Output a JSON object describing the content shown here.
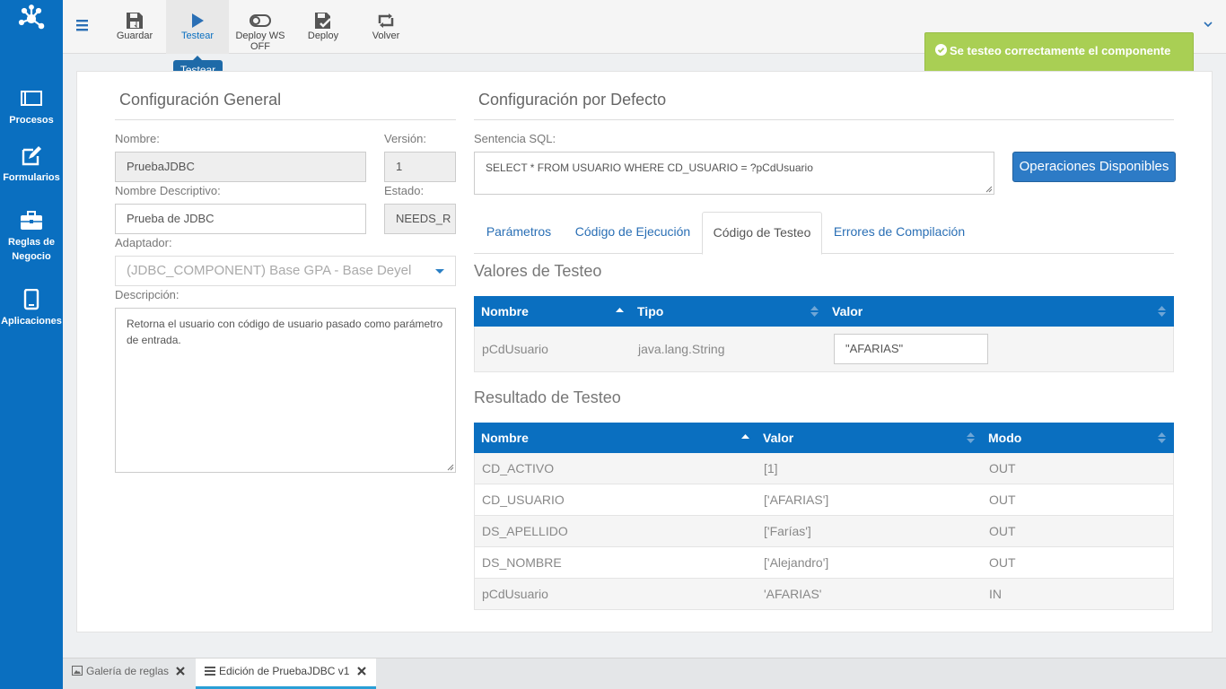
{
  "sidebar": {
    "items": [
      {
        "label": "Procesos",
        "icon": "window-icon"
      },
      {
        "label": "Formularios",
        "icon": "edit-form-icon"
      },
      {
        "label": "Reglas de Negocio",
        "icon": "briefcase-icon"
      },
      {
        "label": "Aplicaciones",
        "icon": "tablet-icon"
      }
    ]
  },
  "toolbar": {
    "items": [
      {
        "label": "Guardar",
        "icon": "save-icon"
      },
      {
        "label": "Testear",
        "icon": "play-icon"
      },
      {
        "label": "Deploy WS OFF",
        "icon": "toggle-off-icon"
      },
      {
        "label": "Deploy",
        "icon": "deploy-icon"
      },
      {
        "label": "Volver",
        "icon": "retweet-icon"
      }
    ],
    "tooltip": "Testear"
  },
  "toast": {
    "message": "Se testeo correctamente el componente",
    "color": "#a9cf54"
  },
  "general": {
    "title": "Configuración General",
    "nombre_label": "Nombre:",
    "nombre_value": "PruebaJDBC",
    "version_label": "Versión:",
    "version_value": "1",
    "descriptivo_label": "Nombre Descriptivo:",
    "descriptivo_value": "Prueba de JDBC",
    "estado_label": "Estado:",
    "estado_value": "NEEDS_R",
    "adaptador_label": "Adaptador:",
    "adaptador_value": "(JDBC_COMPONENT) Base GPA - Base Deyel",
    "descripcion_label": "Descripción:",
    "descripcion_value": "Retorna el usuario con código de usuario pasado como parámetro de entrada."
  },
  "defecto": {
    "title": "Configuración por Defecto",
    "sql_label": "Sentencia SQL:",
    "sql_value": "SELECT * FROM USUARIO WHERE CD_USUARIO = ?pCdUsuario",
    "operaciones_button": "Operaciones Disponibles"
  },
  "tabs": [
    {
      "label": "Parámetros"
    },
    {
      "label": "Código de Ejecución"
    },
    {
      "label": "Código de Testeo"
    },
    {
      "label": "Errores de Compilación"
    }
  ],
  "valores": {
    "title": "Valores de Testeo",
    "headers": [
      "Nombre",
      "Tipo",
      "Valor"
    ],
    "row": {
      "nombre": "pCdUsuario",
      "tipo": "java.lang.String",
      "valor": "\"AFARIAS\""
    }
  },
  "resultado": {
    "title": "Resultado de Testeo",
    "headers": [
      "Nombre",
      "Valor",
      "Modo"
    ],
    "rows": [
      {
        "nombre": "CD_ACTIVO",
        "valor": "[1]",
        "modo": "OUT"
      },
      {
        "nombre": "CD_USUARIO",
        "valor": "['AFARIAS']",
        "modo": "OUT"
      },
      {
        "nombre": "DS_APELLIDO",
        "valor": "['Farías']",
        "modo": "OUT"
      },
      {
        "nombre": "DS_NOMBRE",
        "valor": "['Alejandro']",
        "modo": "OUT"
      },
      {
        "nombre": "pCdUsuario",
        "valor": "'AFARIAS'",
        "modo": "IN"
      }
    ]
  },
  "bottom_tabs": [
    {
      "label": "Galería de reglas",
      "icon": "image-icon"
    },
    {
      "label": "Edición de PruebaJDBC v1",
      "icon": "list-icon"
    }
  ],
  "colors": {
    "brand": "#0a6fc0",
    "header": "#0a6fc0",
    "toast": "#a9cf54",
    "button": "#2d7bc6"
  }
}
